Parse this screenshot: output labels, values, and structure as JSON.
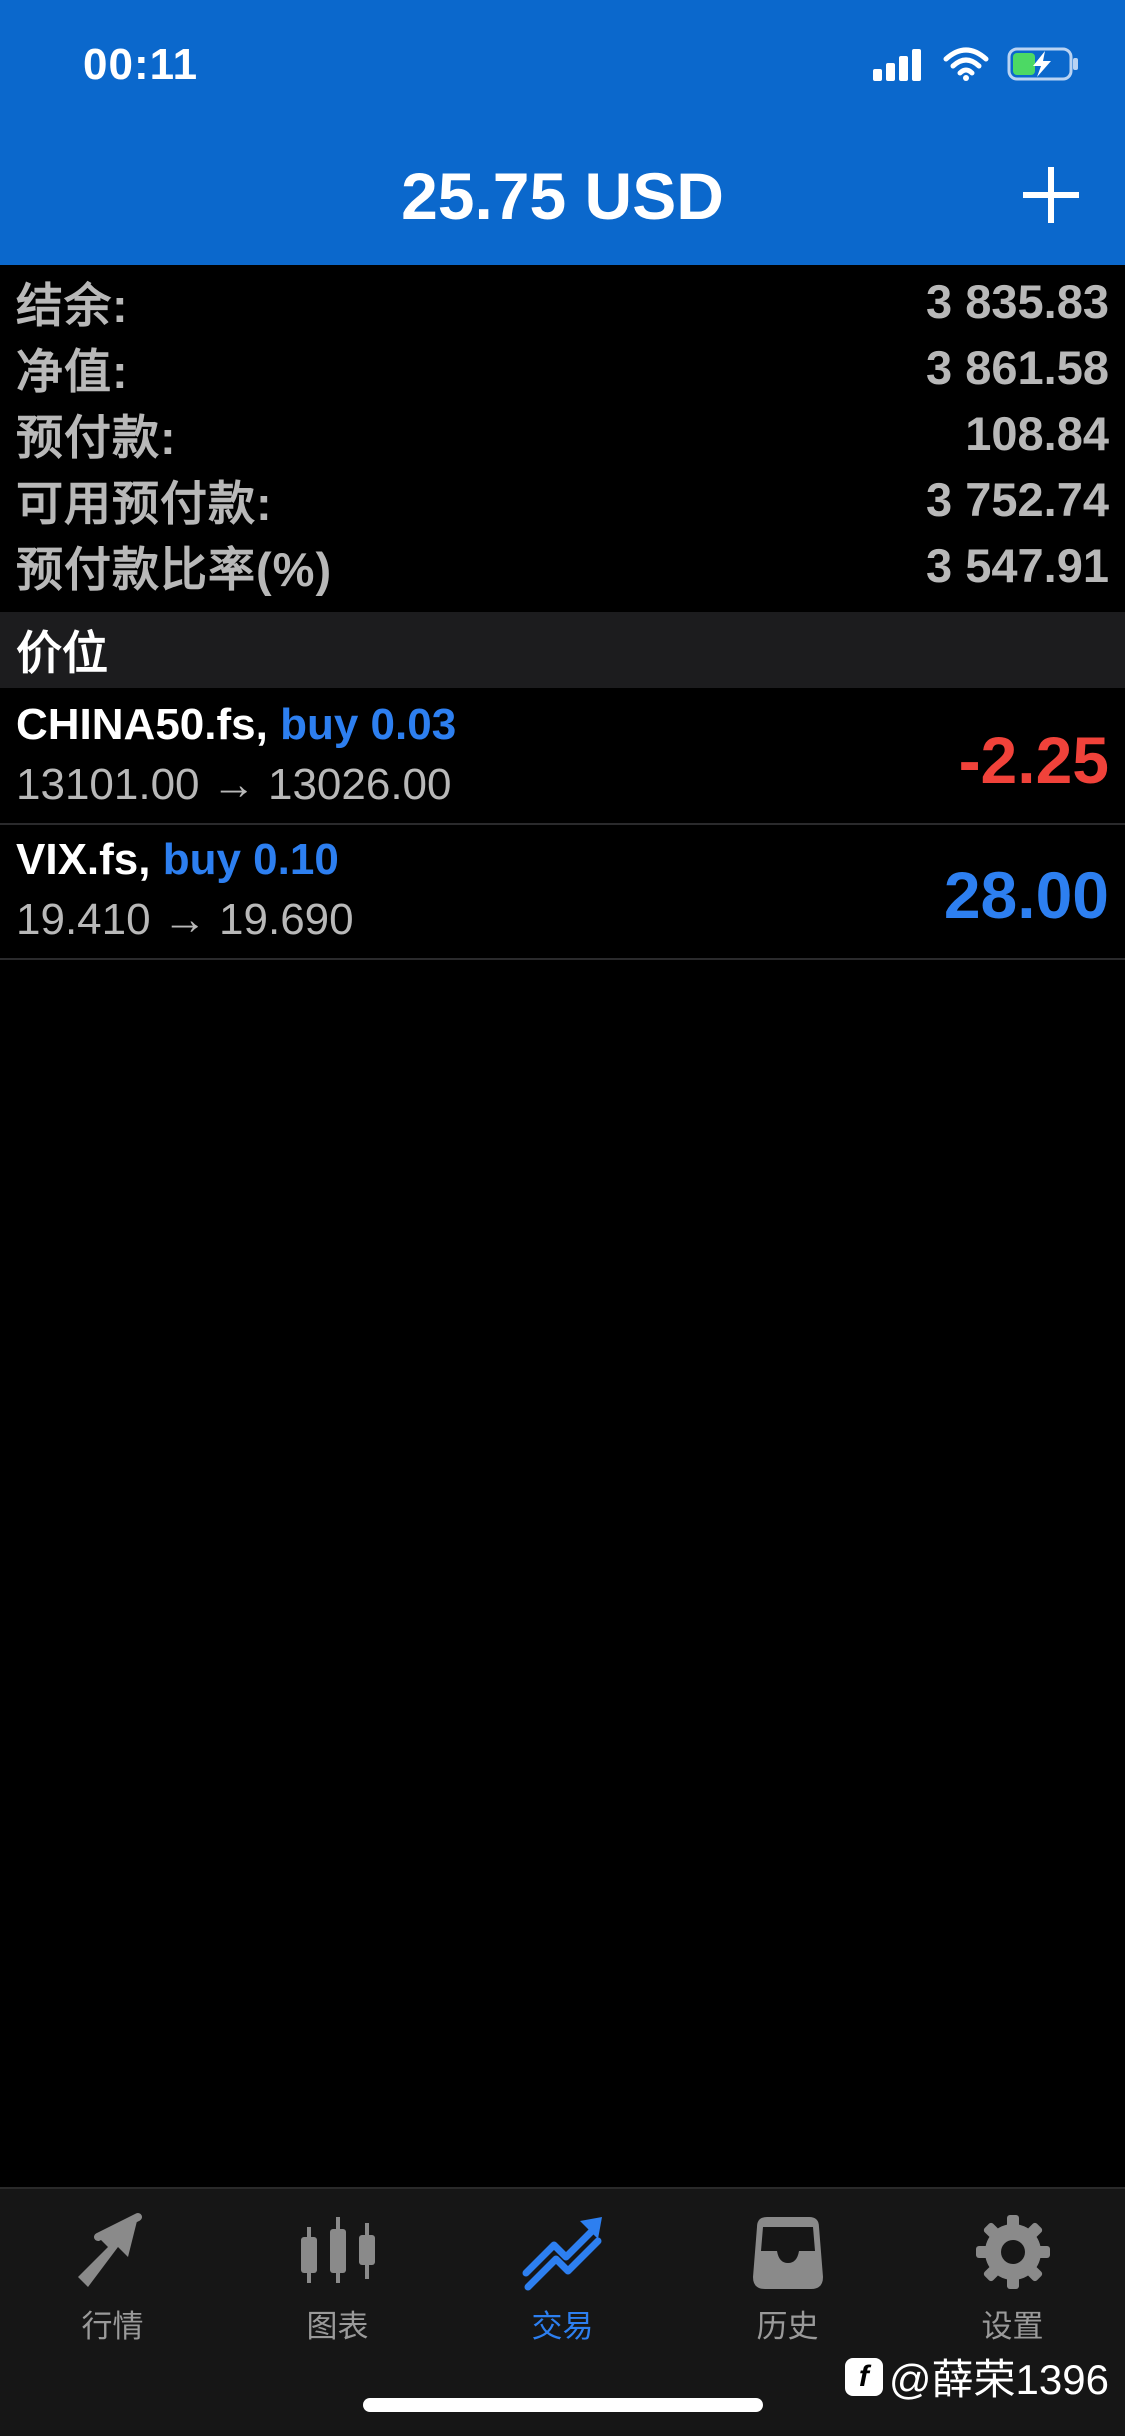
{
  "status_bar": {
    "time": "00:11"
  },
  "header": {
    "title": "25.75 USD"
  },
  "summary": [
    {
      "label": "结余:",
      "value": "3 835.83"
    },
    {
      "label": "净值:",
      "value": "3 861.58"
    },
    {
      "label": "预付款:",
      "value": "108.84"
    },
    {
      "label": "可用预付款:",
      "value": "3 752.74"
    },
    {
      "label": "预付款比率(%)",
      "value": "3 547.91"
    }
  ],
  "positions_header": "价位",
  "positions": [
    {
      "symbol": "CHINA50.fs,",
      "side": "buy 0.03",
      "prices": "13101.00 → 13026.00",
      "profit": "-2.25",
      "profit_color": "#f0423a"
    },
    {
      "symbol": "VIX.fs,",
      "side": "buy 0.10",
      "prices": "19.410 → 19.690",
      "profit": "28.00",
      "profit_color": "#2d7ff0"
    }
  ],
  "tabs": [
    {
      "label": "行情",
      "icon": "quotes-icon",
      "active": false
    },
    {
      "label": "图表",
      "icon": "chart-icon",
      "active": false
    },
    {
      "label": "交易",
      "icon": "trade-icon",
      "active": true
    },
    {
      "label": "历史",
      "icon": "history-icon",
      "active": false
    },
    {
      "label": "设置",
      "icon": "settings-icon",
      "active": false
    }
  ],
  "watermark": {
    "logo_letter": "f",
    "text": "@薛荣1396"
  },
  "colors": {
    "header_bg": "#0b68cc",
    "accent": "#2d7ff0",
    "negative": "#f0423a"
  }
}
